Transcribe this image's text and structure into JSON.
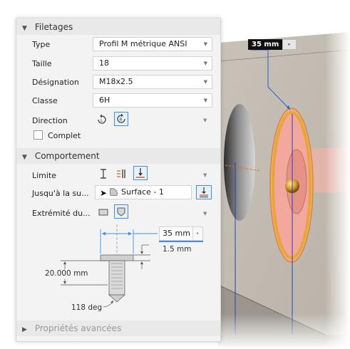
{
  "viewport": {
    "dimension_label": "35 mm",
    "spin_glyph": "▸",
    "colors": {
      "wall": "#c8c1b8",
      "thread": "#e8a63a",
      "face": "#f2a89c"
    }
  },
  "threading": {
    "header": "Filetages",
    "header_icon": "triangle-down",
    "type": {
      "label": "Type",
      "value": "Profil M métrique ANSI"
    },
    "size": {
      "label": "Taille",
      "value": "18"
    },
    "designation": {
      "label": "Désignation",
      "value": "M18x2.5"
    },
    "class": {
      "label": "Classe",
      "value": "6H"
    },
    "direction": {
      "label": "Direction",
      "options": [
        "left-hand-icon",
        "right-hand-icon"
      ],
      "selected": "right-hand-icon"
    },
    "full": {
      "label": "Complet",
      "checked": false
    }
  },
  "behavior": {
    "header": "Comportement",
    "header_icon": "triangle-down",
    "limit": {
      "label": "Limite",
      "options": [
        "distance-icon",
        "through-all-icon",
        "to-icon"
      ],
      "selected": "to-icon"
    },
    "to": {
      "label": "Jusqu'à la su...",
      "value": "Surface - 1"
    },
    "end": {
      "label": "Extrémité du...",
      "options": [
        "flat-end-icon",
        "angle-end-icon"
      ],
      "selected": "angle-end-icon"
    },
    "preview": {
      "diameter": "35 mm",
      "spin_glyph": "▸",
      "offset": "1.5 mm",
      "depth": "20.000 mm",
      "angle": "118 deg"
    }
  },
  "advanced": {
    "header": "Propriétés avancées",
    "header_icon": "triangle-right"
  },
  "accent_color": "#3c8ee6"
}
